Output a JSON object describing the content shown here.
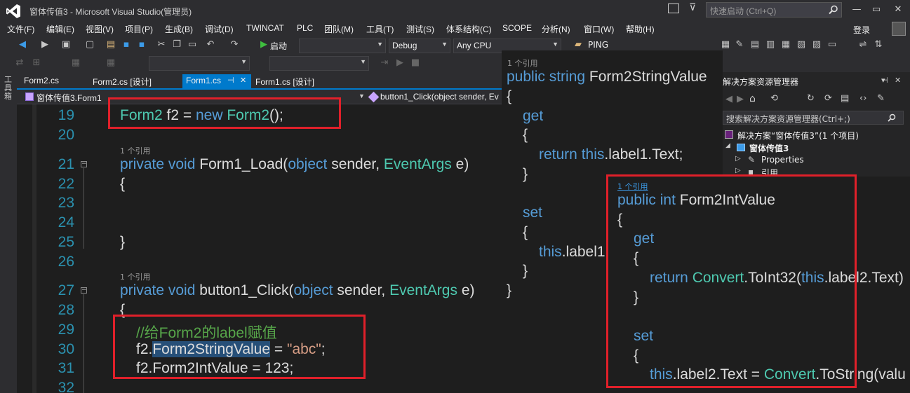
{
  "window": {
    "title": "窗体传值3 - Microsoft Visual Studio(管理员)",
    "quick_launch_placeholder": "快速启动 (Ctrl+Q)",
    "minimize": "—",
    "maximize": "▭",
    "close": "✕"
  },
  "menu": [
    "文件(F)",
    "编辑(E)",
    "视图(V)",
    "项目(P)",
    "生成(B)",
    "调试(D)",
    "TWINCAT",
    "PLC",
    "团队(M)",
    "工具(T)",
    "测试(S)",
    "体系结构(C)",
    "SCOPE",
    "分析(N)",
    "窗口(W)",
    "帮助(H)"
  ],
  "account": "登录",
  "toolbar": {
    "start_label": "启动",
    "config": "Debug",
    "platform": "Any CPU",
    "ping_label": "PING"
  },
  "toolbox_label": "工具箱",
  "tabs": [
    "Form2.cs",
    "Form2.cs [设计]",
    "Form1.cs",
    "Form1.cs [设计]"
  ],
  "tab_pin": "⊣",
  "tab_close": "✕",
  "nav": {
    "class_path": "窗体传值3.Form1",
    "member": "button1_Click(object sender, Ev"
  },
  "editor": {
    "line_numbers": [
      "19",
      "20",
      "21",
      "22",
      "23",
      "24",
      "25",
      "26",
      "27",
      "28",
      "29",
      "30",
      "31",
      "32"
    ],
    "ref_count": "1 个引用",
    "fold_symbol": "−",
    "line19": {
      "t1": "Form2",
      "t2": " f2 = ",
      "t3": "new",
      "t4": " ",
      "t5": "Form2",
      "t6": "();"
    },
    "line21": {
      "t1": "private",
      "t2": " ",
      "t3": "void",
      "t4": " Form1_Load(",
      "t5": "object",
      "t6": " sender, ",
      "t7": "EventArgs",
      "t8": " e)"
    },
    "open_brace": "{",
    "close_brace": "}",
    "line27": {
      "t1": "private",
      "t2": " ",
      "t3": "void",
      "t4": " button1_Click(",
      "t5": "object",
      "t6": " sender, ",
      "t7": "EventArgs",
      "t8": " e)"
    },
    "line29_comment": "//给Form2的label赋值",
    "line30": {
      "t1": "f2.",
      "t2": "Form2StringValue",
      "t3": " = ",
      "t4": "\"abc\"",
      "t5": ";"
    },
    "line31": "f2.Form2IntValue = 123;"
  },
  "solution_explorer": {
    "header": "解决方案资源管理器",
    "search_placeholder": "搜索解决方案资源管理器(Ctrl+;)",
    "solution": "解决方案“窗体传值3”(1 个项目)",
    "project": "窗体传值3",
    "properties": "Properties",
    "references": "引用"
  },
  "panel_string": {
    "ref": "1 个引用",
    "sig": {
      "t1": "public",
      "t2": " ",
      "t3": "string",
      "t4": " Form2StringValue"
    },
    "open": "{",
    "get": "get",
    "inner_open": "{",
    "return_line": {
      "t1": "return",
      "t2": " ",
      "t3": "this",
      "t4": ".label1.Text;"
    },
    "inner_close": "}",
    "set": "set",
    "set_open": "{",
    "set_line": {
      "t1": "this",
      "t2": ".label1"
    },
    "set_close": "}",
    "close": "}"
  },
  "panel_int": {
    "ref": "1 个引用",
    "sig": {
      "t1": "public",
      "t2": " ",
      "t3": "int",
      "t4": " Form2IntValue"
    },
    "open": "{",
    "get": "get",
    "inner_open": "{",
    "return_line": {
      "t1": "return",
      "t2": " ",
      "t3": "Convert",
      "t4": ".ToInt32(",
      "t5": "this",
      "t6": ".label2.Text)"
    },
    "inner_close": "}",
    "set": "set",
    "set_open": "{",
    "set_line": {
      "t1": "this",
      "t2": ".label2.Text = ",
      "t3": "Convert",
      "t4": ".ToString(valu"
    }
  },
  "colors": {
    "keyword": "#569cd6",
    "type": "#4ec9b0",
    "string": "#d69d85",
    "comment": "#57a64a",
    "line_number": "#2b91af",
    "annotation_box": "#e0202a",
    "accent": "#007acc"
  }
}
